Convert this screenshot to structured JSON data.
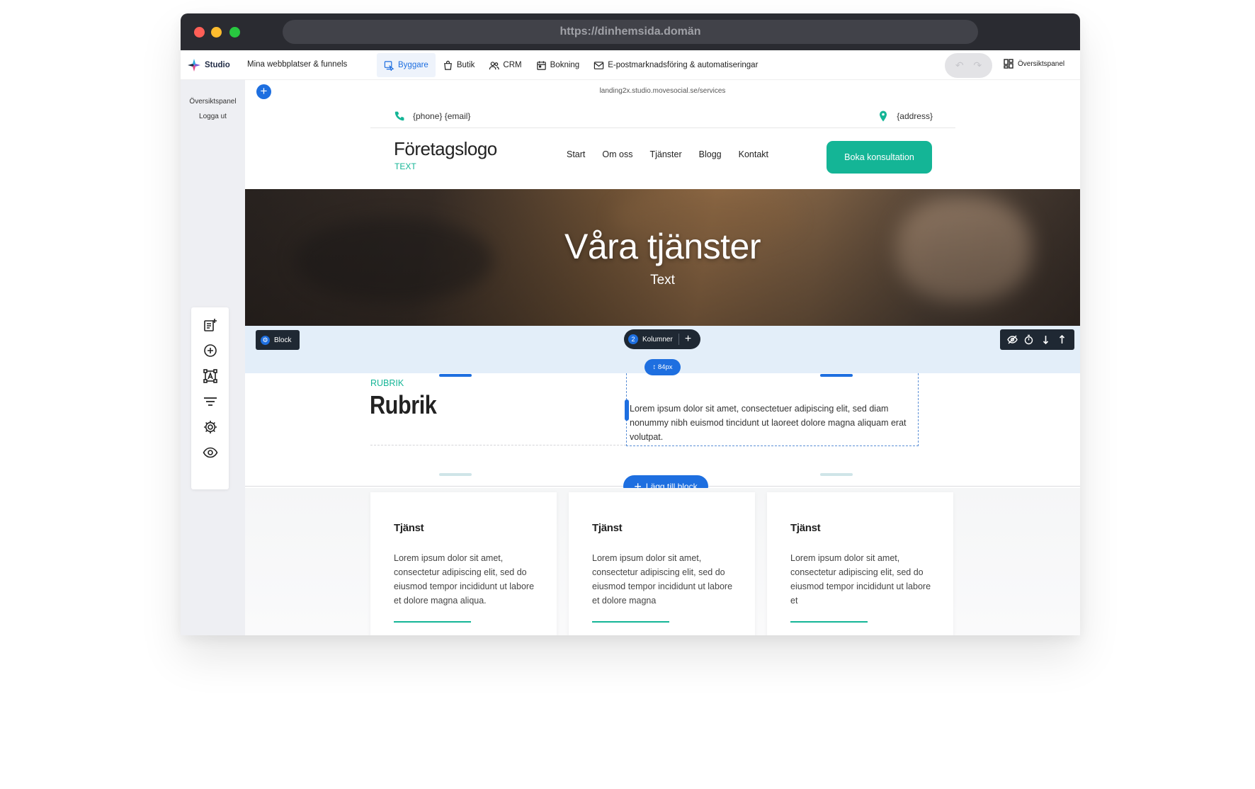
{
  "browser": {
    "url": "https://dinhemsida.domän"
  },
  "topbar": {
    "brand": "Studio",
    "sites_link": "Mina webbplatser & funnels",
    "tabs": [
      {
        "label": "Byggare",
        "icon": "builder-icon",
        "active": true
      },
      {
        "label": "Butik",
        "icon": "shopping-bag-icon",
        "active": false
      },
      {
        "label": "CRM",
        "icon": "users-icon",
        "active": false
      },
      {
        "label": "Bokning",
        "icon": "calendar-icon",
        "active": false
      },
      {
        "label": "E-postmarknadsföring & automatiseringar",
        "icon": "mail-icon",
        "active": false
      }
    ],
    "overview_label": "Översiktspanel"
  },
  "left_panel": {
    "overview_link": "Översiktspanel",
    "logout_link": "Logga ut",
    "tools": [
      "add-page-icon",
      "add-element-icon",
      "text-frame-icon",
      "filter-icon",
      "gear-icon",
      "eye-icon"
    ]
  },
  "page": {
    "url": "landing2x.studio.movesocial.se/services",
    "contact": {
      "phone_email": "{phone} {email}",
      "address": "{address}"
    },
    "header": {
      "logo_title": "Företagslogo",
      "logo_sub": "TEXT",
      "nav": [
        "Start",
        "Om oss",
        "Tjänster",
        "Blogg",
        "Kontakt"
      ],
      "cta": "Boka konsultation"
    },
    "hero": {
      "title": "Våra tjänster",
      "subtitle": "Text"
    },
    "editor": {
      "block_label": "Block",
      "columns_count": "2",
      "columns_label": "Kolumner",
      "spacing_label": "↕ 84px",
      "add_block_label": "Lägg till block"
    },
    "section": {
      "eyebrow": "RUBRIK",
      "heading": "Rubrik",
      "body": "Lorem ipsum dolor sit amet, consectetuer adipiscing elit, sed diam nonummy nibh euismod tincidunt ut laoreet dolore magna aliquam erat volutpat."
    },
    "services": [
      {
        "title": "Tjänst",
        "text": "Lorem ipsum dolor sit amet, consectetur adipiscing elit, sed do eiusmod tempor incididunt ut labore et dolore magna aliqua."
      },
      {
        "title": "Tjänst",
        "text": "Lorem ipsum dolor sit amet, consectetur adipiscing elit, sed do eiusmod tempor incididunt ut labore et dolore magna"
      },
      {
        "title": "Tjänst",
        "text": "Lorem ipsum dolor sit amet, consectetur adipiscing elit, sed do eiusmod tempor incididunt ut labore et"
      }
    ]
  },
  "colors": {
    "accent": "#14b596",
    "editor_blue": "#1e6fe0",
    "dark_ui": "#1f2833",
    "chrome": "#2a2b31"
  }
}
